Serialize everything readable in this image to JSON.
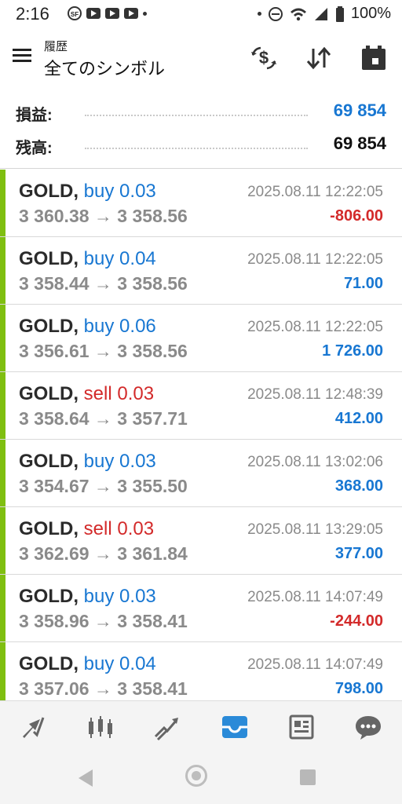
{
  "status_bar": {
    "time": "2:16",
    "battery": "100%"
  },
  "header": {
    "subtitle": "履歴",
    "title": "全てのシンボル"
  },
  "summary": {
    "profit_label": "損益:",
    "profit_value": "69 854",
    "balance_label": "残高:",
    "balance_value": "69 854"
  },
  "trades": [
    {
      "symbol": "GOLD,",
      "side": "buy",
      "volume": "0.03",
      "prices": "3 360.38 → 3 358.56",
      "time": "2025.08.11 12:22:05",
      "profit": "-806.00"
    },
    {
      "symbol": "GOLD,",
      "side": "buy",
      "volume": "0.04",
      "prices": "3 358.44 → 3 358.56",
      "time": "2025.08.11 12:22:05",
      "profit": "71.00"
    },
    {
      "symbol": "GOLD,",
      "side": "buy",
      "volume": "0.06",
      "prices": "3 356.61 → 3 358.56",
      "time": "2025.08.11 12:22:05",
      "profit": "1 726.00"
    },
    {
      "symbol": "GOLD,",
      "side": "sell",
      "volume": "0.03",
      "prices": "3 358.64 → 3 357.71",
      "time": "2025.08.11 12:48:39",
      "profit": "412.00"
    },
    {
      "symbol": "GOLD,",
      "side": "buy",
      "volume": "0.03",
      "prices": "3 354.67 → 3 355.50",
      "time": "2025.08.11 13:02:06",
      "profit": "368.00"
    },
    {
      "symbol": "GOLD,",
      "side": "sell",
      "volume": "0.03",
      "prices": "3 362.69 → 3 361.84",
      "time": "2025.08.11 13:29:05",
      "profit": "377.00"
    },
    {
      "symbol": "GOLD,",
      "side": "buy",
      "volume": "0.03",
      "prices": "3 358.96 → 3 358.41",
      "time": "2025.08.11 14:07:49",
      "profit": "-244.00"
    },
    {
      "symbol": "GOLD,",
      "side": "buy",
      "volume": "0.04",
      "prices": "3 357.06 → 3 358.41",
      "time": "2025.08.11 14:07:49",
      "profit": "798.00"
    }
  ],
  "colors": {
    "accent_blue": "#1877d2",
    "loss_red": "#d32a2a",
    "trade_bar_green": "#7fbf10"
  },
  "tabs": [
    "quotes-icon",
    "chart-icon",
    "trade-icon",
    "history-icon",
    "news-icon",
    "chat-icon"
  ]
}
